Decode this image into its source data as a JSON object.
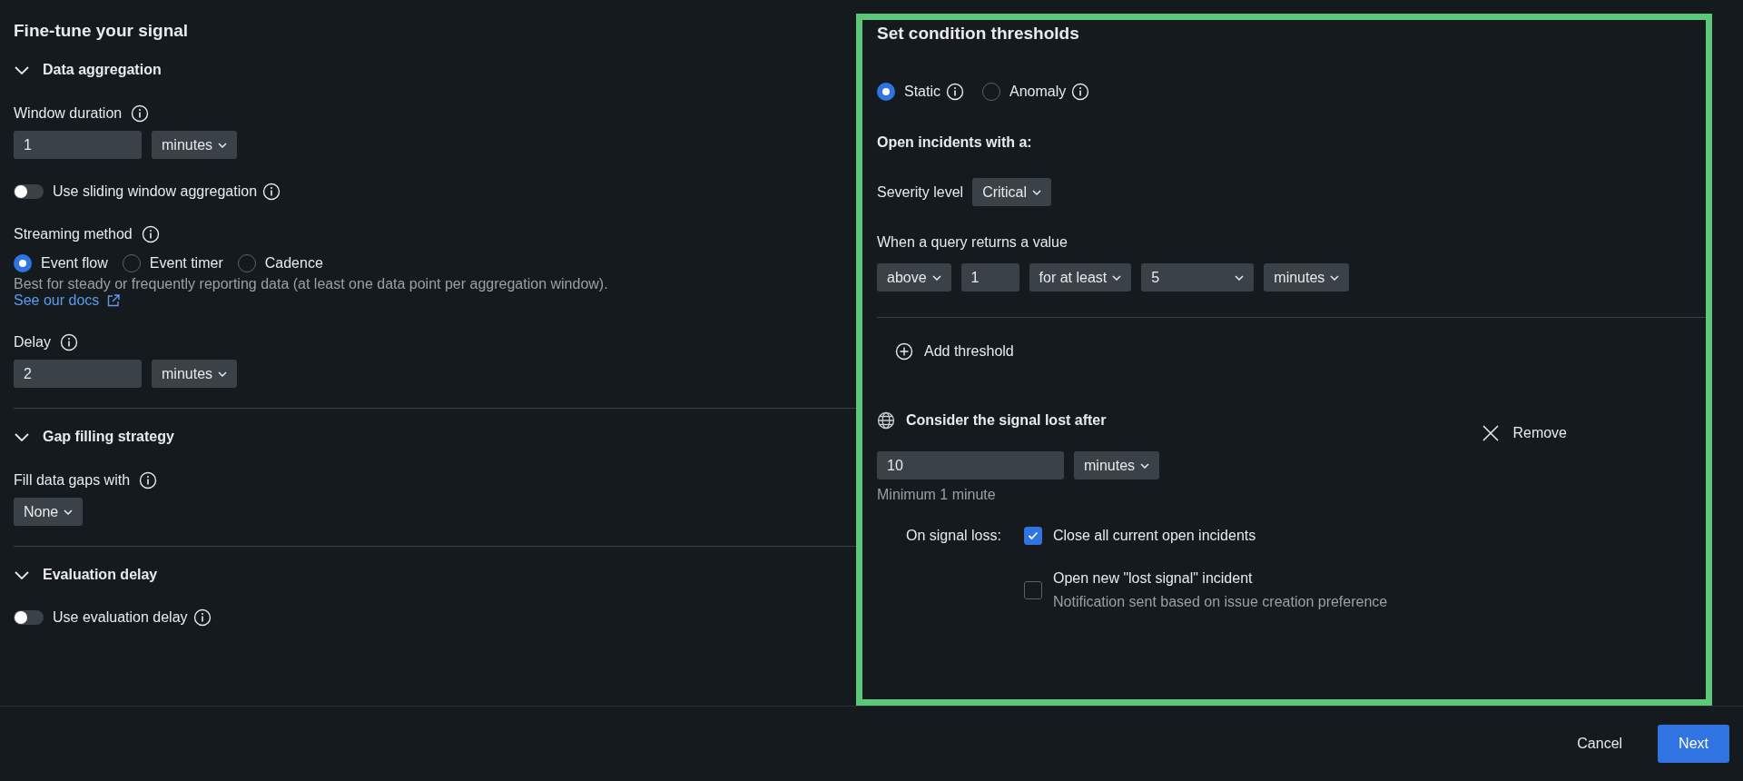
{
  "left": {
    "title": "Fine-tune your signal",
    "sections": [
      {
        "title": "Data aggregation",
        "expanded": true,
        "fields": [
          {
            "kind": "input-unit",
            "label": "Window duration",
            "info": true,
            "value": "1",
            "unit": "minutes"
          },
          {
            "kind": "toggle",
            "label": "Use sliding window aggregation",
            "info": true,
            "on": false
          },
          {
            "kind": "radio",
            "label": "Streaming method",
            "info": true,
            "options": [
              {
                "label": "Event flow",
                "selected": true
              },
              {
                "label": "Event timer",
                "selected": false
              },
              {
                "label": "Cadence",
                "selected": false
              }
            ],
            "help": "Best for steady or frequently reporting data (at least one data point per aggregation window).",
            "link": "See our docs"
          },
          {
            "kind": "input-unit",
            "label": "Delay",
            "info": true,
            "value": "2",
            "unit": "minutes"
          }
        ]
      },
      {
        "title": "Gap filling strategy",
        "expanded": true,
        "fields": [
          {
            "kind": "select",
            "label": "Fill data gaps with",
            "info": true,
            "value": "None"
          }
        ]
      },
      {
        "title": "Evaluation delay",
        "expanded": true,
        "fields": [
          {
            "kind": "toggle",
            "label": "Use evaluation delay",
            "info": true,
            "on": false
          }
        ]
      }
    ]
  },
  "right": {
    "title": "Set condition thresholds",
    "modes": [
      {
        "label": "Static",
        "selected": true
      },
      {
        "label": "Anomaly",
        "selected": false
      }
    ],
    "subtitle": "Open incidents with a:",
    "severity": {
      "label": "Severity level",
      "value": "Critical"
    },
    "query": {
      "label": "When a query returns a value",
      "controls": [
        {
          "kind": "select",
          "value": "above"
        },
        {
          "kind": "input",
          "value": "1"
        },
        {
          "kind": "select",
          "value": "for at least"
        },
        {
          "kind": "select-wide",
          "value": "5"
        },
        {
          "kind": "select",
          "value": "minutes"
        }
      ]
    },
    "add_threshold": "Add threshold",
    "signal_loss": {
      "title": "Consider the signal lost after",
      "remove": "Remove",
      "value": "10",
      "unit": "minutes",
      "hint": "Minimum 1 minute",
      "label": "On signal loss:",
      "options": [
        {
          "label": "Close all current open incidents",
          "checked": true
        },
        {
          "label": "Open new \"lost signal\" incident",
          "checked": false,
          "note": "Notification sent based on issue creation preference"
        }
      ]
    }
  },
  "footer": {
    "buttons": [
      {
        "label": "Cancel",
        "kind": "secondary"
      },
      {
        "label": "Next",
        "kind": "primary"
      }
    ]
  }
}
